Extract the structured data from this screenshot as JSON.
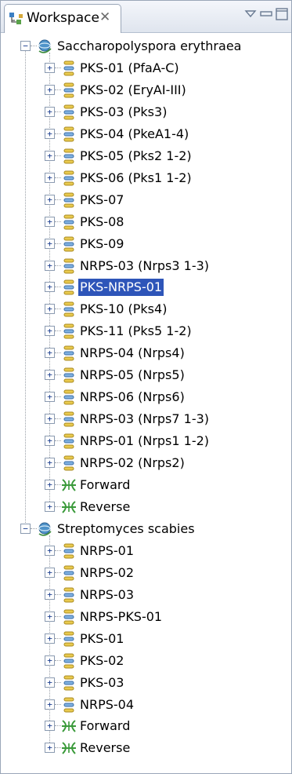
{
  "tab": {
    "title": "Workspace",
    "close_glyph": "✕"
  },
  "view_buttons": [
    "view-menu-icon",
    "minimize-icon",
    "maximize-icon"
  ],
  "colors": {
    "selection": "#2e55b9",
    "gene_icon": "#c8a23a",
    "forward_icon": "#3a9a3a"
  },
  "tree": [
    {
      "label": "Saccharopolyspora erythraea",
      "icon": "genome-icon",
      "expanded": true,
      "children": [
        {
          "label": "PKS-01 (PfaA-C)",
          "icon": "cluster-icon"
        },
        {
          "label": "PKS-02 (EryAI-III)",
          "icon": "cluster-icon"
        },
        {
          "label": "PKS-03 (Pks3)",
          "icon": "cluster-icon"
        },
        {
          "label": "PKS-04 (PkeA1-4)",
          "icon": "cluster-icon"
        },
        {
          "label": "PKS-05 (Pks2 1-2)",
          "icon": "cluster-icon"
        },
        {
          "label": "PKS-06 (Pks1 1-2)",
          "icon": "cluster-icon"
        },
        {
          "label": "PKS-07",
          "icon": "cluster-icon"
        },
        {
          "label": "PKS-08",
          "icon": "cluster-icon"
        },
        {
          "label": "PKS-09",
          "icon": "cluster-icon"
        },
        {
          "label": "NRPS-03 (Nrps3 1-3)",
          "icon": "cluster-icon"
        },
        {
          "label": "PKS-NRPS-01",
          "icon": "cluster-icon",
          "selected": true
        },
        {
          "label": "PKS-10 (Pks4)",
          "icon": "cluster-icon"
        },
        {
          "label": "PKS-11 (Pks5 1-2)",
          "icon": "cluster-icon"
        },
        {
          "label": "NRPS-04 (Nrps4)",
          "icon": "cluster-icon"
        },
        {
          "label": "NRPS-05 (Nrps5)",
          "icon": "cluster-icon"
        },
        {
          "label": "NRPS-06 (Nrps6)",
          "icon": "cluster-icon"
        },
        {
          "label": "NRPS-03 (Nrps7 1-3)",
          "icon": "cluster-icon"
        },
        {
          "label": "NRPS-01 (Nrps1 1-2)",
          "icon": "cluster-icon"
        },
        {
          "label": "NRPS-02 (Nrps2)",
          "icon": "cluster-icon"
        },
        {
          "label": "Forward",
          "icon": "strand-icon"
        },
        {
          "label": "Reverse",
          "icon": "strand-icon"
        }
      ]
    },
    {
      "label": "Streptomyces scabies",
      "icon": "genome-icon",
      "expanded": true,
      "children": [
        {
          "label": "NRPS-01",
          "icon": "cluster-icon"
        },
        {
          "label": "NRPS-02",
          "icon": "cluster-icon"
        },
        {
          "label": "NRPS-03",
          "icon": "cluster-icon"
        },
        {
          "label": "NRPS-PKS-01",
          "icon": "cluster-icon"
        },
        {
          "label": "PKS-01",
          "icon": "cluster-icon"
        },
        {
          "label": "PKS-02",
          "icon": "cluster-icon"
        },
        {
          "label": "PKS-03",
          "icon": "cluster-icon"
        },
        {
          "label": "NRPS-04",
          "icon": "cluster-icon"
        },
        {
          "label": "Forward",
          "icon": "strand-icon"
        },
        {
          "label": "Reverse",
          "icon": "strand-icon"
        }
      ]
    }
  ]
}
